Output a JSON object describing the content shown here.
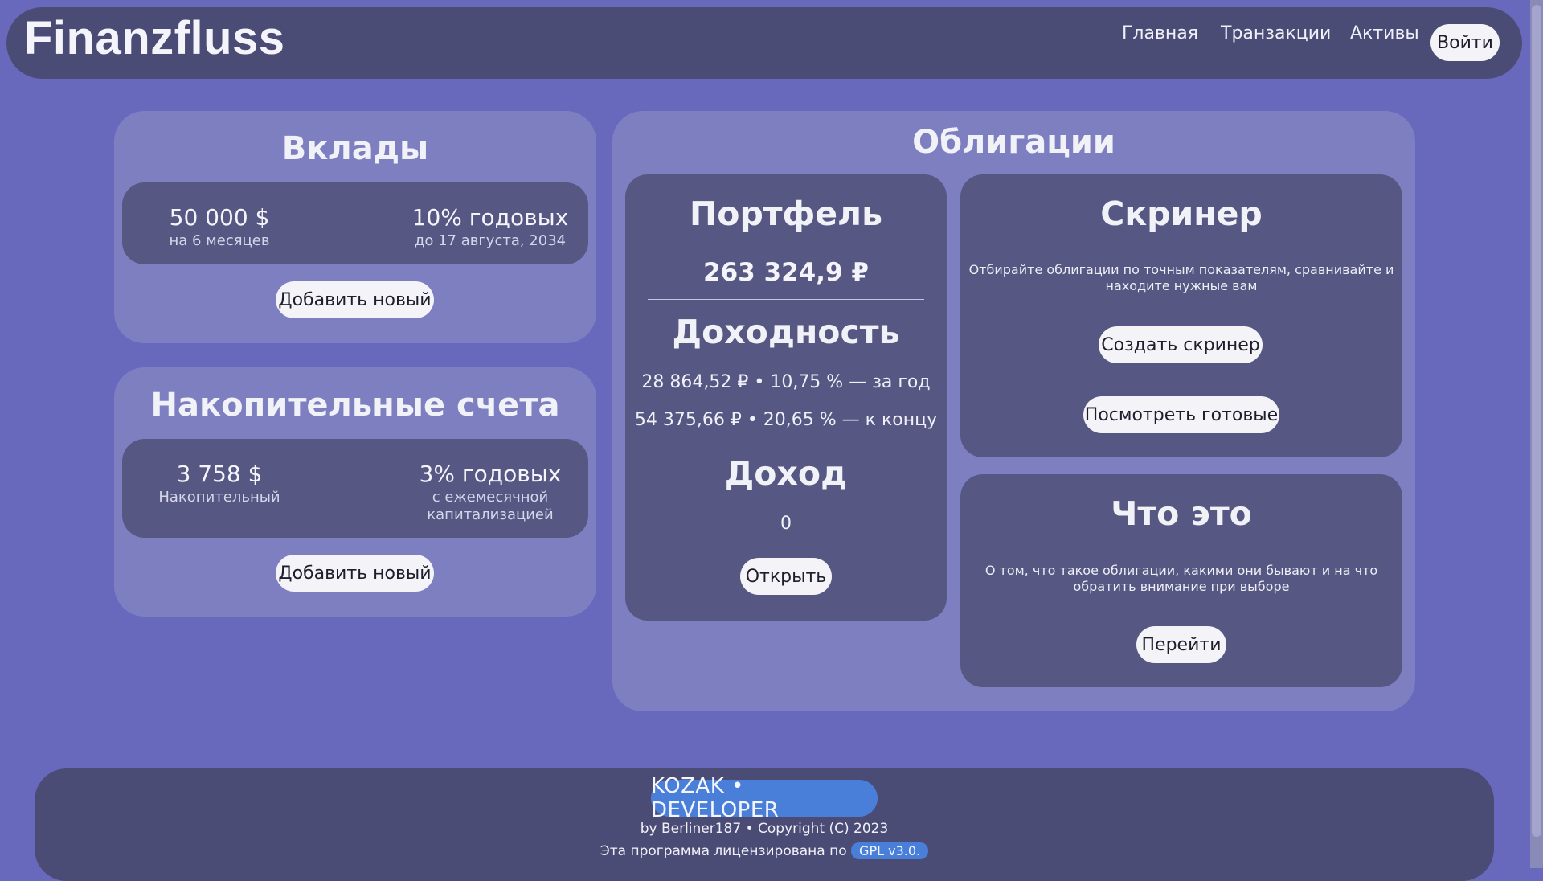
{
  "nav": {
    "brand": "Finanzfluss",
    "links": [
      "Главная",
      "Транзакции",
      "Активы"
    ],
    "login": "Войти"
  },
  "deposits": {
    "title": "Вклады",
    "amount": "50 000 $",
    "amount_sub": "на 6 месяцев",
    "rate": "10% годовых",
    "rate_sub": "до 17 августа, 2034",
    "add": "Добавить новый"
  },
  "savings": {
    "title": "Накопительные счета",
    "amount": "3 758 $",
    "amount_sub": "Накопительный",
    "rate": "3% годовых",
    "rate_sub_1": "с ежемесячной",
    "rate_sub_2": "капитализацией",
    "add": "Добавить новый"
  },
  "bonds": {
    "title": "Облигации",
    "portfolio": {
      "title": "Портфель",
      "value": "263 324,9 ₽",
      "yield_title": "Доходность",
      "yield_year": "28 864,52 ₽ • 10,75 % — за год",
      "yield_end": "54 375,66 ₽ • 20,65 % — к концу",
      "income_title": "Доход",
      "income_value": "0",
      "open": "Открыть"
    },
    "screener": {
      "title": "Скринер",
      "desc_1": "Отбирайте облигации по точным показателям, сравнивайте и",
      "desc_2": "находите нужные вам",
      "create": "Создать скринер",
      "view": "Посмотреть готовые"
    },
    "about": {
      "title": "Что это",
      "desc_1": "О том, что такое облигации, какими они бывают и на что",
      "desc_2": "обратить внимание при выборе",
      "go": "Перейти"
    }
  },
  "footer": {
    "badge": "KOZAK • DEVELOPER",
    "copyright": "by Berliner187 • Copyright (C) 2023",
    "license_text": "Эта программа лицензирована по",
    "license_badge": "GPL v3.0."
  },
  "colors": {
    "background": "#6869bd",
    "navbar": "#4b4c76",
    "panel": "#7e7fc1",
    "card": "#565782",
    "accent": "#4a7fd9"
  }
}
